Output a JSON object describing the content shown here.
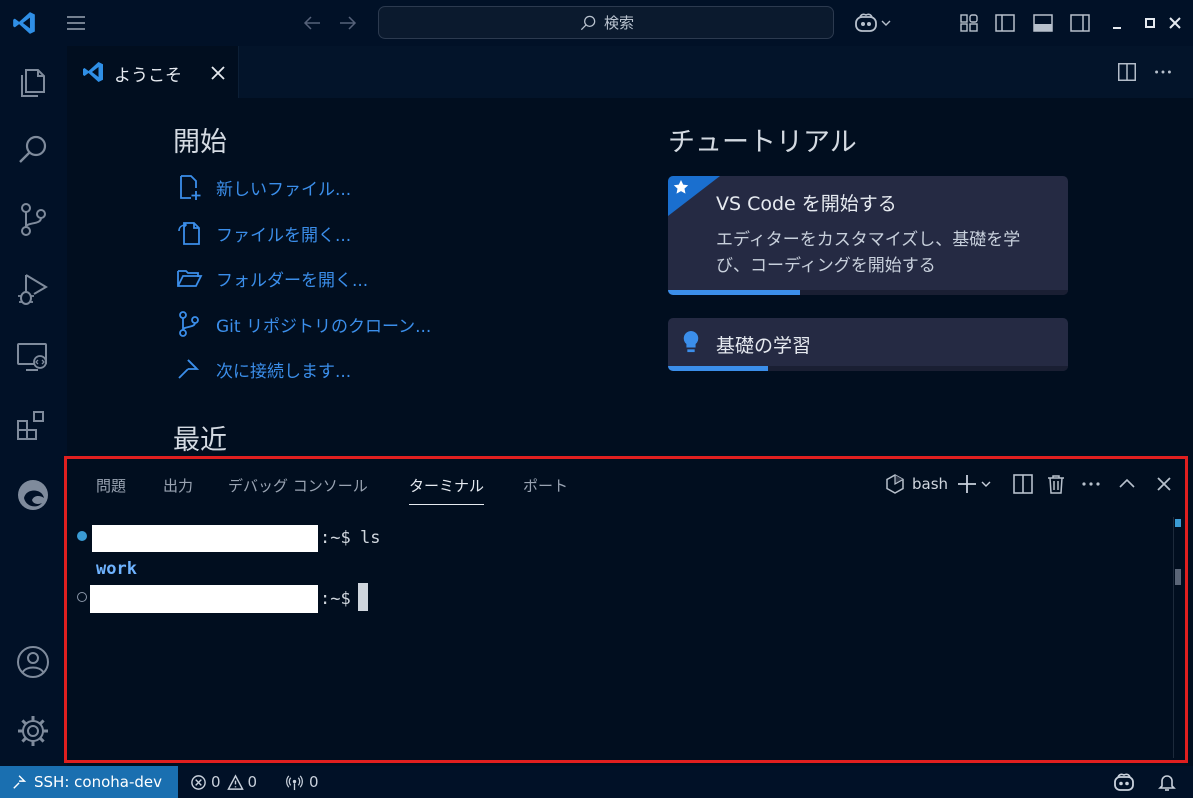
{
  "titlebar": {
    "search_label": "検索"
  },
  "tab": {
    "label": "ようこそ"
  },
  "welcome": {
    "start_title": "開始",
    "start_items": [
      "新しいファイル...",
      "ファイルを開く...",
      "フォルダーを開く...",
      "Git リポジトリのクローン...",
      "次に接続します..."
    ],
    "recent_title": "最近",
    "tutorials_title": "チュートリアル",
    "cards": [
      {
        "title": "VS Code を開始する",
        "desc_line1": "エディターをカスタマイズし、基礎を学",
        "desc_line2": "び、コーディングを開始する",
        "progress": 0.33
      },
      {
        "title": "基礎の学習",
        "progress": 0.25
      }
    ]
  },
  "panel": {
    "tabs": [
      "問題",
      "出力",
      "デバッグ コンソール",
      "ターミナル",
      "ポート"
    ],
    "active_tab": "ターミナル",
    "shell_label": "bash"
  },
  "terminal": {
    "prompt_suffix": ":~$",
    "command": "ls",
    "output": "work"
  },
  "statusbar": {
    "remote": "SSH: conoha-dev",
    "errors": "0",
    "warnings": "0",
    "ports": "0"
  },
  "colors": {
    "accent": "#3b8eea",
    "remote_bg": "#1a6fb0",
    "highlight_border": "#e01f1f"
  }
}
